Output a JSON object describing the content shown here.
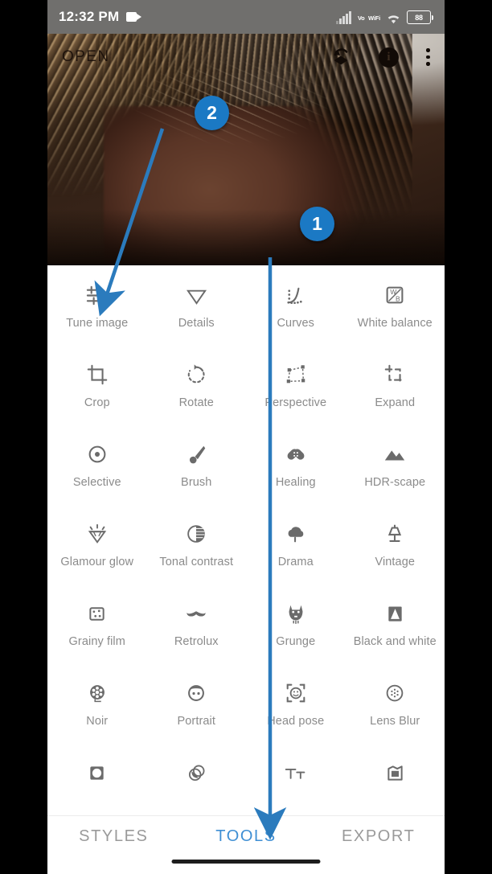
{
  "status_bar": {
    "time": "12:32 PM",
    "recording_icon": "video-camera-icon",
    "signal_icon": "cellular-signal-icon",
    "volte_line1": "Vo",
    "volte_line2": "WiFi",
    "wifi_icon": "wifi-icon",
    "battery_level": "88"
  },
  "app_bar": {
    "open_label": "OPEN",
    "revert_icon": "revert-layers-icon",
    "info_icon": "info-icon",
    "menu_icon": "overflow-menu-icon"
  },
  "tools": {
    "rows": [
      [
        {
          "label": "Tune image",
          "icon": "tune-sliders-icon"
        },
        {
          "label": "Details",
          "icon": "details-triangle-icon"
        },
        {
          "label": "Curves",
          "icon": "curves-icon"
        },
        {
          "label": "White balance",
          "icon": "white-balance-icon"
        }
      ],
      [
        {
          "label": "Crop",
          "icon": "crop-icon"
        },
        {
          "label": "Rotate",
          "icon": "rotate-icon"
        },
        {
          "label": "Perspective",
          "icon": "perspective-icon"
        },
        {
          "label": "Expand",
          "icon": "expand-icon"
        }
      ],
      [
        {
          "label": "Selective",
          "icon": "selective-target-icon"
        },
        {
          "label": "Brush",
          "icon": "brush-icon"
        },
        {
          "label": "Healing",
          "icon": "healing-bandage-icon"
        },
        {
          "label": "HDR-scape",
          "icon": "mountains-icon"
        }
      ],
      [
        {
          "label": "Glamour glow",
          "icon": "diamond-glow-icon"
        },
        {
          "label": "Tonal contrast",
          "icon": "contrast-circle-icon"
        },
        {
          "label": "Drama",
          "icon": "cloud-rain-icon"
        },
        {
          "label": "Vintage",
          "icon": "lamp-icon"
        }
      ],
      [
        {
          "label": "Grainy film",
          "icon": "grain-square-icon"
        },
        {
          "label": "Retrolux",
          "icon": "moustache-icon"
        },
        {
          "label": "Grunge",
          "icon": "grunge-mask-icon"
        },
        {
          "label": "Black and white",
          "icon": "black-white-square-icon"
        }
      ],
      [
        {
          "label": "Noir",
          "icon": "film-reel-icon"
        },
        {
          "label": "Portrait",
          "icon": "portrait-face-icon"
        },
        {
          "label": "Head pose",
          "icon": "head-pose-icon"
        },
        {
          "label": "Lens Blur",
          "icon": "lens-blur-icon"
        }
      ],
      [
        {
          "label": "",
          "icon": "vignette-icon"
        },
        {
          "label": "",
          "icon": "double-exposure-icon"
        },
        {
          "label": "",
          "icon": "text-icon"
        },
        {
          "label": "",
          "icon": "frames-icon"
        }
      ]
    ]
  },
  "tab_bar": {
    "tabs": [
      {
        "label": "STYLES",
        "active": false
      },
      {
        "label": "TOOLS",
        "active": true
      },
      {
        "label": "EXPORT",
        "active": false
      }
    ]
  },
  "annotations": {
    "accent_color": "#1b79c4",
    "markers": [
      {
        "number": "1",
        "points_to": "TOOLS tab"
      },
      {
        "number": "2",
        "points_to": "Tune image tool"
      }
    ]
  }
}
